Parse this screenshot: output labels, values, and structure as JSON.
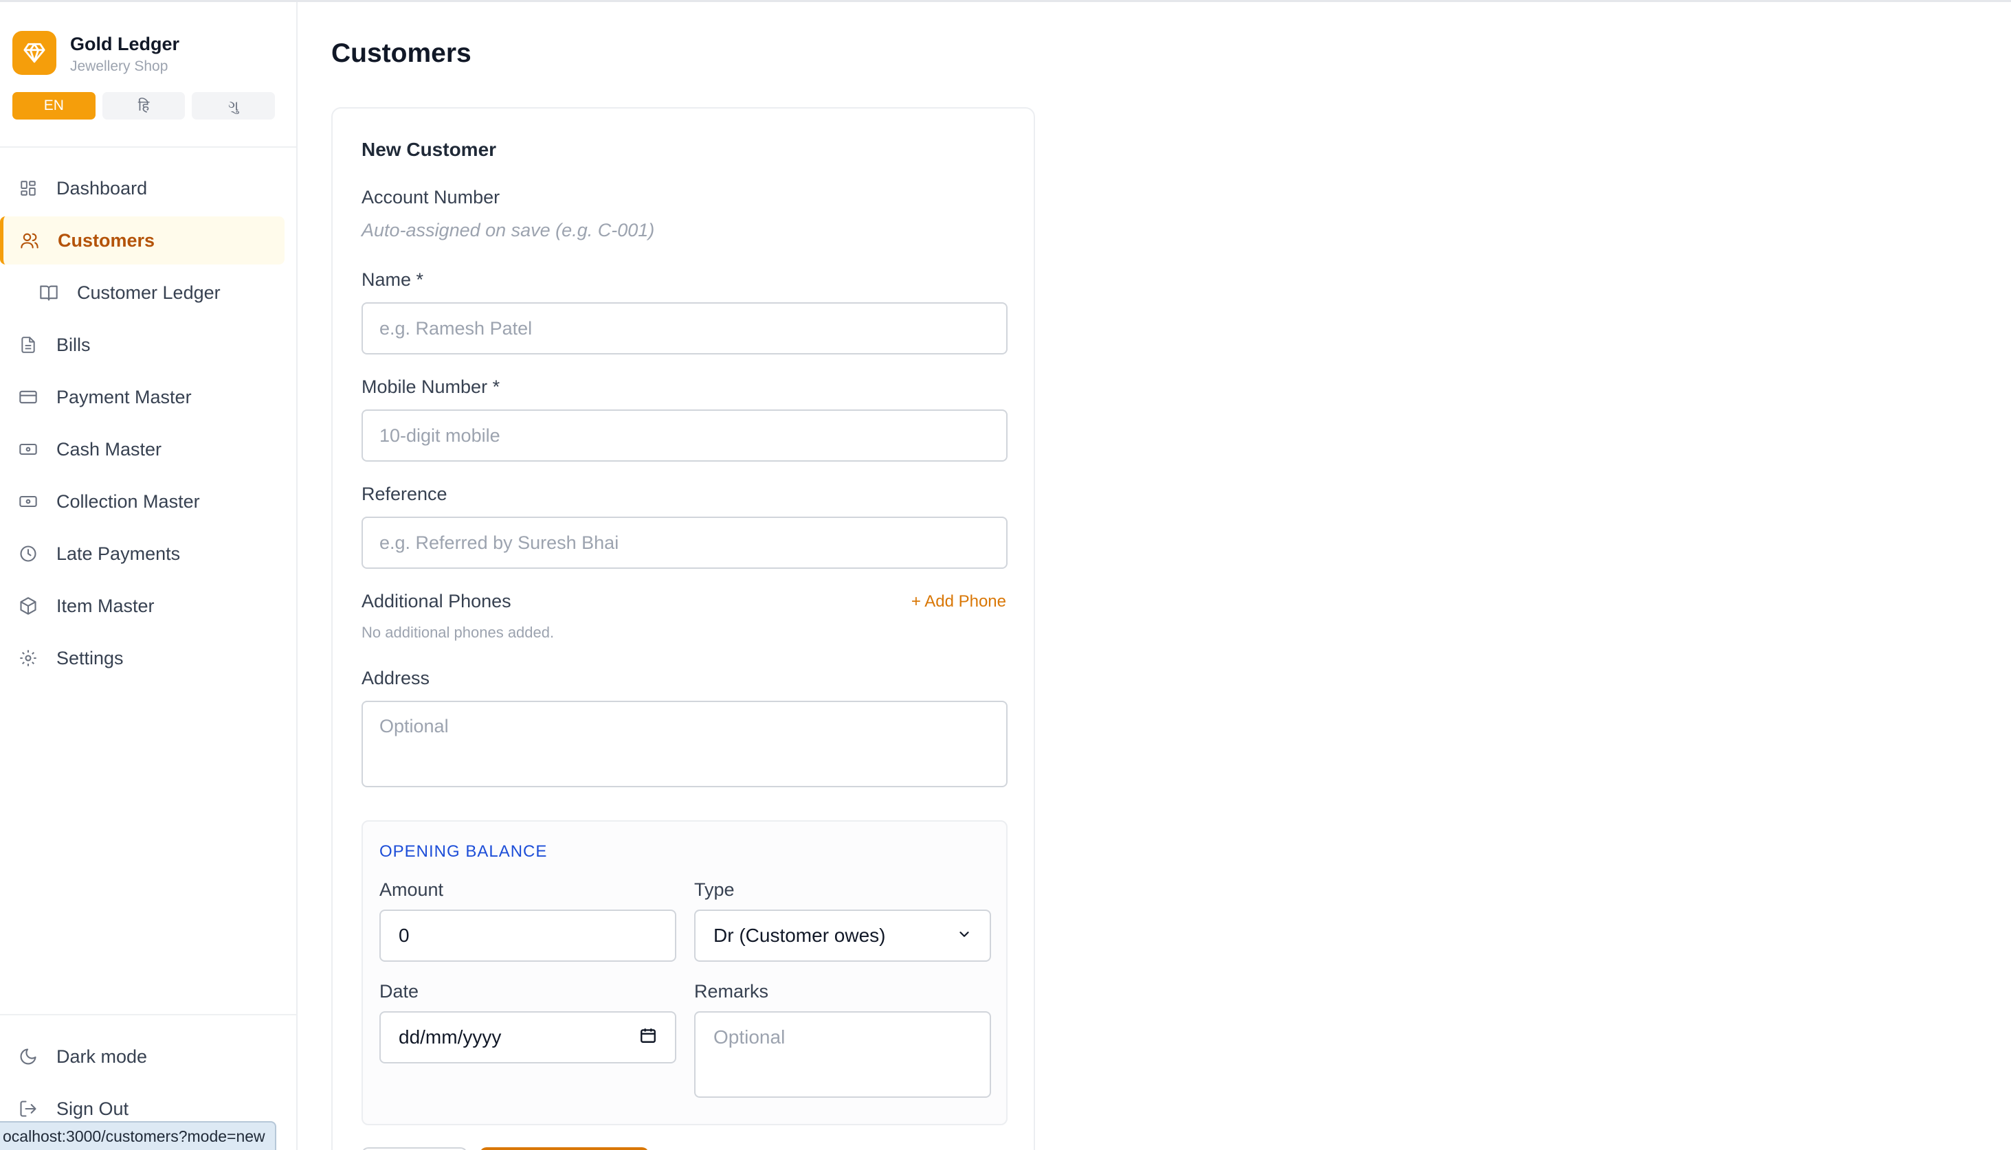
{
  "brand": {
    "name": "Gold Ledger",
    "subtitle": "Jewellery Shop",
    "logo_icon": "gem-icon",
    "accent": "#f59e0b"
  },
  "languages": [
    {
      "label": "EN",
      "active": true
    },
    {
      "label": "हि",
      "active": false
    },
    {
      "label": "ગુ",
      "active": false
    }
  ],
  "nav": {
    "dashboard": "Dashboard",
    "customers": "Customers",
    "customer_ledger": "Customer Ledger",
    "bills": "Bills",
    "payment_master": "Payment Master",
    "cash_master": "Cash Master",
    "collection_master": "Collection Master",
    "late_payments": "Late Payments",
    "item_master": "Item Master",
    "settings": "Settings",
    "dark_mode": "Dark mode",
    "sign_out": "Sign Out"
  },
  "status_url": "ocalhost:3000/customers?mode=new",
  "page": {
    "title": "Customers"
  },
  "form": {
    "title": "New Customer",
    "account_number_label": "Account Number",
    "account_number_hint": "Auto-assigned on save (e.g. C-001)",
    "name_label": "Name *",
    "name_placeholder": "e.g. Ramesh Patel",
    "mobile_label": "Mobile Number *",
    "mobile_placeholder": "10-digit mobile",
    "reference_label": "Reference",
    "reference_placeholder": "e.g. Referred by Suresh Bhai",
    "additional_phones_label": "Additional Phones",
    "add_phone_link": "+ Add Phone",
    "no_phones_note": "No additional phones added.",
    "address_label": "Address",
    "address_placeholder": "Optional"
  },
  "opening_balance": {
    "title": "OPENING BALANCE",
    "amount_label": "Amount",
    "amount_value": "0",
    "type_label": "Type",
    "type_value": "Dr (Customer owes)",
    "date_label": "Date",
    "date_value": "dd/mm/yyyy",
    "remarks_label": "Remarks",
    "remarks_placeholder": "Optional"
  }
}
